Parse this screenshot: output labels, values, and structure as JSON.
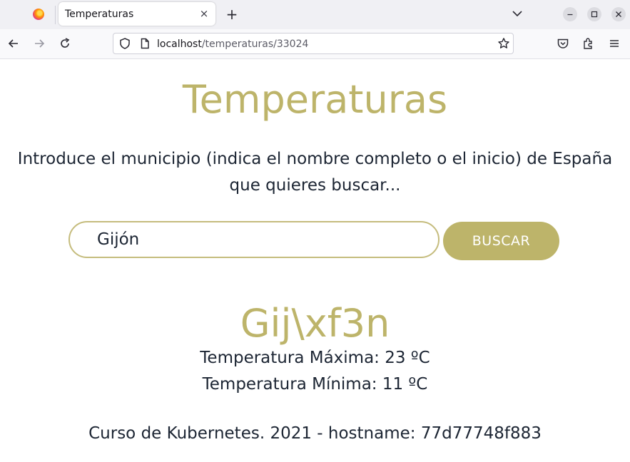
{
  "browser": {
    "tab_title": "Temperaturas",
    "close_tab_glyph": "×",
    "new_tab_glyph": "+",
    "url_host": "localhost",
    "url_path": "/temperaturas/33024",
    "icons": [
      "firefox-logo-icon",
      "list-all-tabs-icon",
      "minimize-icon",
      "maximize-icon",
      "close-window-icon",
      "back-icon",
      "forward-icon",
      "reload-icon",
      "shield-icon",
      "page-icon",
      "star-icon",
      "pocket-icon",
      "extensions-icon",
      "menu-icon"
    ]
  },
  "page": {
    "heading": "Temperaturas",
    "intro": "Introduce el municipio (indica el nombre completo o el inicio) de España que quieres buscar...",
    "search_value": "Gijón",
    "search_button": "BUSCAR",
    "city_name": "Gij\\xf3n",
    "max_temp": "Temperatura Máxima: 23 ºC",
    "min_temp": "Temperatura Mínima: 11 ºC",
    "footer": "Curso de Kubernetes. 2021 - hostname: 77d77748f883"
  },
  "colors": {
    "accent": "#bdb46a",
    "input_border": "#c5bc7d",
    "text": "#1c2533"
  }
}
